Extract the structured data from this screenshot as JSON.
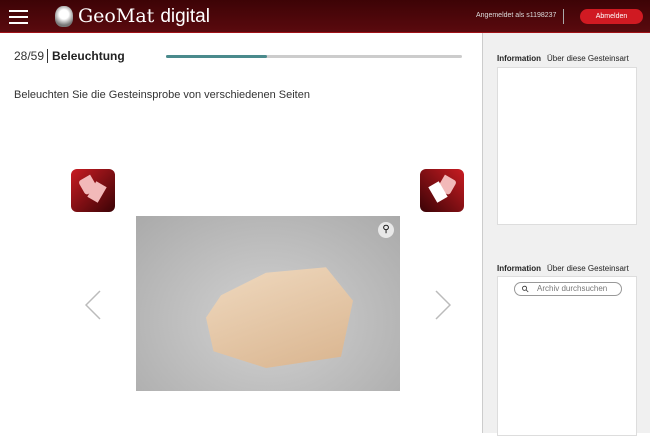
{
  "header": {
    "brand_main": "GeoMat",
    "brand_sub": "digital",
    "user": "Angemeldet als s1198237",
    "logout": "Abmelden"
  },
  "task": {
    "counter": "28/59",
    "title": "Beleuchtung",
    "progress": 0.34,
    "instruction": "Beleuchten Sie die Gesteinsprobe von verschiedenen Seiten"
  },
  "sidebar": {
    "panel1": {
      "tabs": [
        "Information",
        "Über diese Gesteinsart"
      ]
    },
    "panel2": {
      "tabs": [
        "Information",
        "Über diese Gesteinsart"
      ],
      "search_placeholder": "Archiv durchsuchen"
    }
  }
}
